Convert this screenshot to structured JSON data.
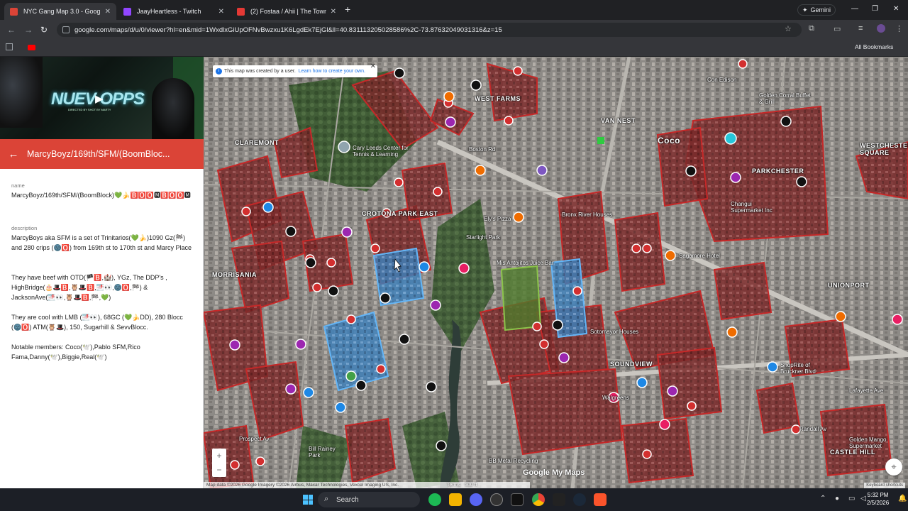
{
  "browser": {
    "tabs": [
      {
        "title": "NYC Gang Map 3.0 - Google M",
        "color": "#db4437",
        "active": true
      },
      {
        "title": "JaayHeartless - Twitch",
        "color": "#9146ff",
        "active": false
      },
      {
        "title": "(2) Fostaa / Ahii | The Towns Ro",
        "color": "#e53935",
        "active": false
      }
    ],
    "gemini_label": "Gemini",
    "url": "google.com/maps/d/u/0/viewer?hl=en&mid=1WxdlxGiUpOFNvBwzxu1K6LgdEk7EjGl&ll=40.831113205028586%2C-73.87632049031316&z=15",
    "all_bookmarks": "All Bookmarks"
  },
  "panel": {
    "video_overlay_text": "NUEV  OPPS",
    "video_credit": "DIRECTED BY SHOT BY MARTY",
    "title": "MarcyBoyz/169th/SFM/(BoomBloc...",
    "name_label": "name",
    "name_value": "MarcyBoyz/169th/SFM/(BoomBlock)💚🍌🅱️🅾️🅾️🅼️🅱️🅾️🅾️🅼️",
    "description_label": "description",
    "description_p1": "MarcyBoys aka SFM is a set of Trinitarios(💚🍌)1090 Gz(🏁) and 280 crips (🌚🅾️) from 169th st to 170th st and Marcy Place",
    "description_p2": "They have beef with OTD(🏴🅱️,🏰), YGz, The DDP's , HighBridge(🎂🎩🅱️,🦉🎩🅱️,🌁👀,🌚🅾️,🏁) & JacksonAve(🌁👀,🦉🎩🅱️,🏁,💚)",
    "description_p3": "They are cool with LMB (🌁👀), 68GC (💚🍌DD), 280 Blocc (🌚🅾️) ATM(🦉🎩), 150, Sugarhill & SevvBlocc.",
    "description_p4": "Notable members: Coco(🕊️),Pablo SFM,Rico Fama,Danny(🕊️),Biggie,Real(🕊️)"
  },
  "map": {
    "notice_text": "This map was created by a user.",
    "notice_link": "Learn how to create your own.",
    "labels": [
      {
        "text": "CLAREMONT",
        "big": true
      },
      {
        "text": "CROTONA PARK EAST",
        "big": true
      },
      {
        "text": "WEST FARMS",
        "big": true
      },
      {
        "text": "VAN NEST",
        "big": true
      },
      {
        "text": "PARKCHESTER",
        "big": true
      },
      {
        "text": "SOUNDVIEW",
        "big": true
      },
      {
        "text": "UNIONPORT",
        "big": true
      },
      {
        "text": "MORRISANIA",
        "big": true
      },
      {
        "text": "CASTLE HILL",
        "big": true
      },
      {
        "text": "WESTCHESTER SQUARE",
        "big": true
      },
      {
        "text": "Cary Leeds Center for Tennis & Learning",
        "big": false
      },
      {
        "text": "Starlight Park",
        "big": false
      },
      {
        "text": "Bronx River Houses",
        "big": false
      },
      {
        "text": "Golden Corral Buffet & Grill",
        "big": false
      },
      {
        "text": "Coco",
        "big": false
      },
      {
        "text": "Mis Antojitos Juice Bar",
        "big": false
      },
      {
        "text": "Lafayette Ave",
        "big": false
      },
      {
        "text": "Sotomayor Houses",
        "big": false
      },
      {
        "text": "BB Metal Recycling",
        "big": false
      },
      {
        "text": "Bill Rainey Park",
        "big": false
      },
      {
        "text": "Con Edison",
        "big": false
      },
      {
        "text": "Boston Rd",
        "big": false
      },
      {
        "text": "Prospect Av",
        "big": false
      },
      {
        "text": "Sagamore Hotel",
        "big": false
      },
      {
        "text": "Ely's Pizza",
        "big": false
      },
      {
        "text": "Walgreens",
        "big": false
      },
      {
        "text": "Randall Av",
        "big": false
      },
      {
        "text": "Golden Mango Supermarket",
        "big": false
      },
      {
        "text": "ShopRite of Bruckner Blvd",
        "big": false
      },
      {
        "text": "Changui Supermarket Inc",
        "big": false
      }
    ],
    "brand": "Google My Maps",
    "attribution": "Map data ©2026 Google Imagery ©2026 Airbus, Maxar Technologies, Vexcel Imaging US, Inc.",
    "terms": "Terms",
    "scale": "500 ft",
    "keyboard_shortcuts": "Keyboard shortcuts"
  },
  "taskbar": {
    "search_placeholder": "Search",
    "time": "5:32 PM",
    "date": "2/5/2026"
  }
}
